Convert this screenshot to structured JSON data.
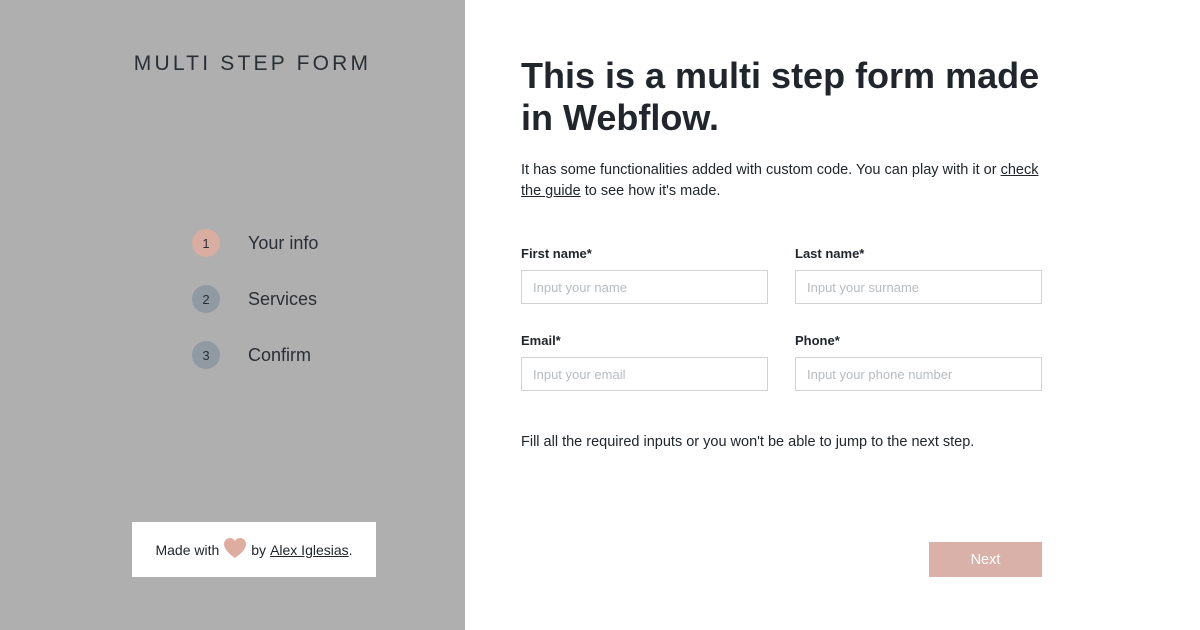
{
  "sidebar": {
    "brand": "MULTI STEP FORM",
    "steps": [
      {
        "number": "1",
        "label": "Your info",
        "active": true
      },
      {
        "number": "2",
        "label": "Services",
        "active": false
      },
      {
        "number": "3",
        "label": "Confirm",
        "active": false
      }
    ],
    "credit": {
      "prefix": "Made with",
      "by": "by",
      "author": "Alex Iglesias",
      "suffix": "."
    }
  },
  "main": {
    "title": "This is a multi step form made in Webflow.",
    "intro": {
      "text_before": "It has some functionalities added with custom code. You can play with it or ",
      "link": "check the guide",
      "text_after": " to see how it's made."
    },
    "fields": {
      "first_name": {
        "label": "First name*",
        "placeholder": "Input your name",
        "value": ""
      },
      "last_name": {
        "label": "Last name*",
        "placeholder": "Input your surname",
        "value": ""
      },
      "email": {
        "label": "Email*",
        "placeholder": "Input your email",
        "value": ""
      },
      "phone": {
        "label": "Phone*",
        "placeholder": "Input your phone number",
        "value": ""
      }
    },
    "hint": "Fill all the required inputs or you won't be able to jump to the next step.",
    "next_label": "Next"
  },
  "colors": {
    "sidebar_bg": "#afafaf",
    "active_step": "#d9ada0",
    "inactive_step": "#8f9aa3",
    "accent": "#d9b1a8",
    "text": "#20262b"
  },
  "icons": {
    "credit_heart": "heart-icon"
  }
}
